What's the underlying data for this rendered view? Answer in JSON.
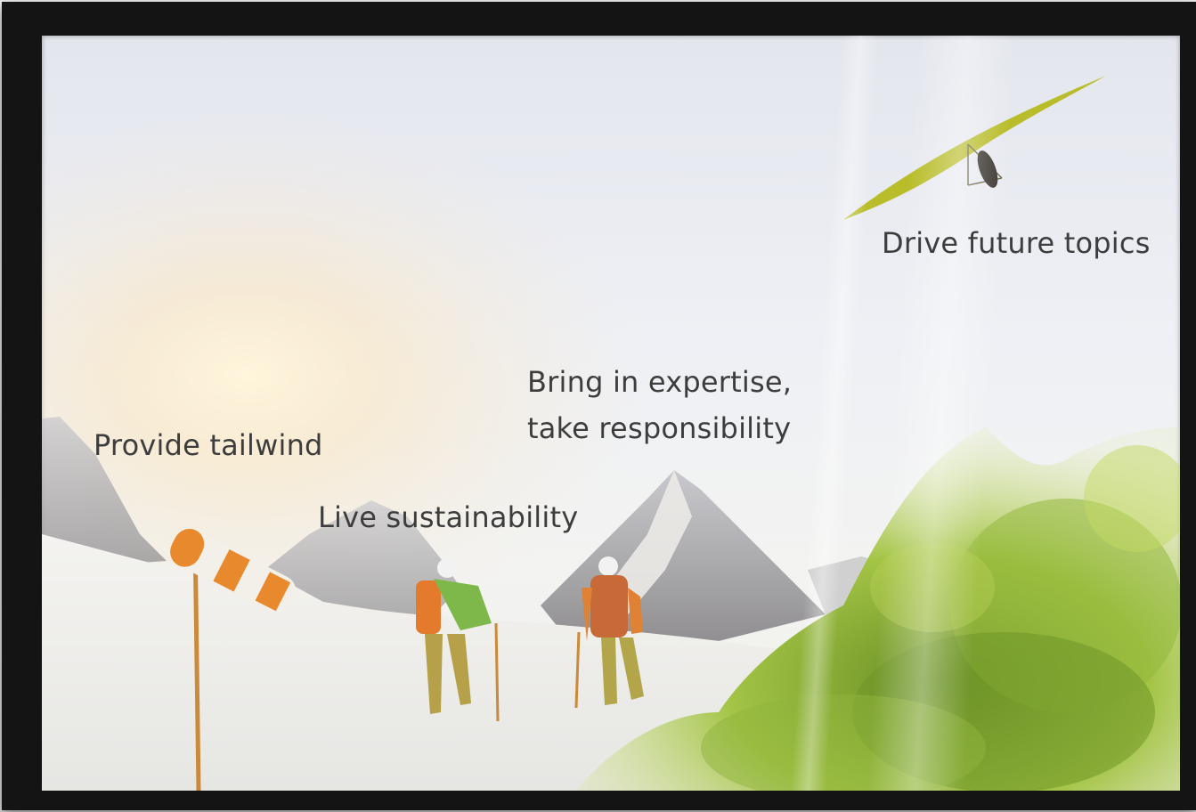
{
  "labels": {
    "drive_future": "Drive future topics",
    "expertise_line1": "Bring in expertise,",
    "expertise_line2": "take responsibility",
    "tailwind": "Provide tailwind",
    "sustainability": "Live sustainability"
  },
  "colors": {
    "frame": "#141414",
    "text": "#3d3d3d",
    "sky": "#e8eaf0",
    "glider_wing": "#b9bd2a",
    "windsock_orange": "#e8892e",
    "foliage": "#8cb33a"
  }
}
